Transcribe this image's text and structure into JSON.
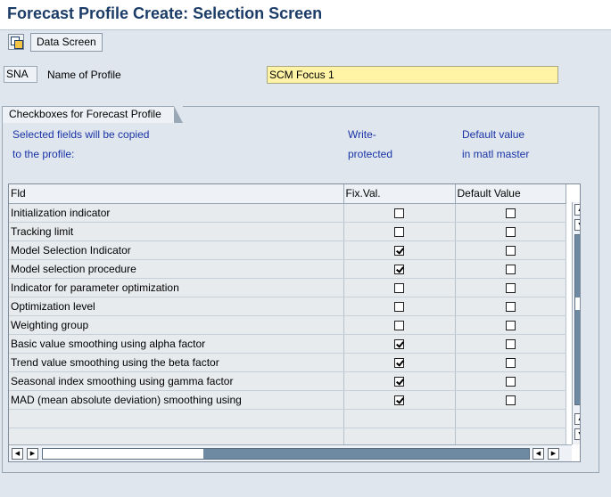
{
  "window": {
    "title": "Forecast Profile Create: Selection Screen"
  },
  "toolbar": {
    "data_screen_label": "Data Screen"
  },
  "profile": {
    "code": "SNA",
    "name_label": "Name of Profile",
    "name_value": "SCM Focus 1"
  },
  "group": {
    "title": "Checkboxes for Forecast Profile",
    "col1_line1": "Selected fields will be copied",
    "col1_line2": "to the profile:",
    "col2_line1": "Write-",
    "col2_line2": "protected",
    "col3_line1": "Default value",
    "col3_line2": "in matl master"
  },
  "table": {
    "headers": [
      "Fld",
      "Fix.Val.",
      "Default Value"
    ],
    "rows": [
      {
        "field": "Initialization indicator",
        "fix": false,
        "def": false
      },
      {
        "field": "Tracking limit",
        "fix": false,
        "def": false
      },
      {
        "field": "Model Selection Indicator",
        "fix": true,
        "def": false
      },
      {
        "field": "Model selection procedure",
        "fix": true,
        "def": false
      },
      {
        "field": "Indicator for parameter optimization",
        "fix": false,
        "def": false
      },
      {
        "field": "Optimization level",
        "fix": false,
        "def": false
      },
      {
        "field": "Weighting group",
        "fix": false,
        "def": false
      },
      {
        "field": "Basic value smoothing using alpha factor",
        "fix": true,
        "def": false
      },
      {
        "field": "Trend value smoothing using the beta factor",
        "fix": true,
        "def": false
      },
      {
        "field": "Seasonal index smoothing using gamma factor",
        "fix": true,
        "def": false
      },
      {
        "field": "MAD (mean absolute deviation) smoothing using",
        "fix": true,
        "def": false
      }
    ],
    "empty_rows": 2
  },
  "icons": {
    "toolbar_icon": "copy-screen-icon",
    "scroll_up": "arrow-up-icon",
    "scroll_down": "arrow-down-icon"
  }
}
